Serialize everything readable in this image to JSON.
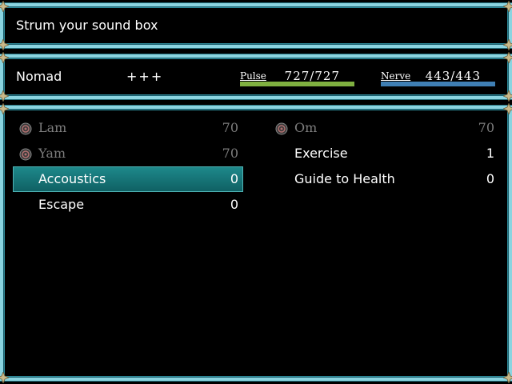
{
  "help": {
    "text": "Strum your sound box"
  },
  "actor": {
    "name": "Nomad",
    "state": "+++",
    "pulse": {
      "label": "Pulse",
      "current": 727,
      "max": 727,
      "text": "727/727",
      "color": "#7fb040",
      "fill": 1.0
    },
    "nerve": {
      "label": "Nerve",
      "current": 443,
      "max": 443,
      "text": "443/443",
      "color": "#3f7fb4",
      "fill": 1.0
    }
  },
  "skills": {
    "left": [
      {
        "name": "Lam",
        "cost": "70",
        "icon": "seal-icon",
        "enabled": false
      },
      {
        "name": "Yam",
        "cost": "70",
        "icon": "seal-icon",
        "enabled": false
      },
      {
        "name": "Accoustics",
        "cost": "0",
        "icon": "",
        "enabled": true,
        "selected": true
      },
      {
        "name": "Escape",
        "cost": "0",
        "icon": "",
        "enabled": true
      }
    ],
    "right": [
      {
        "name": "Om",
        "cost": "70",
        "icon": "seal-icon",
        "enabled": false
      },
      {
        "name": "Exercise",
        "cost": "1",
        "icon": "",
        "enabled": true
      },
      {
        "name": "Guide to Health",
        "cost": "0",
        "icon": "",
        "enabled": true
      }
    ]
  },
  "colors": {
    "frame": "#8ad4e0",
    "selection": "#1e8a8c",
    "disabled_text": "#7d7d7d"
  }
}
